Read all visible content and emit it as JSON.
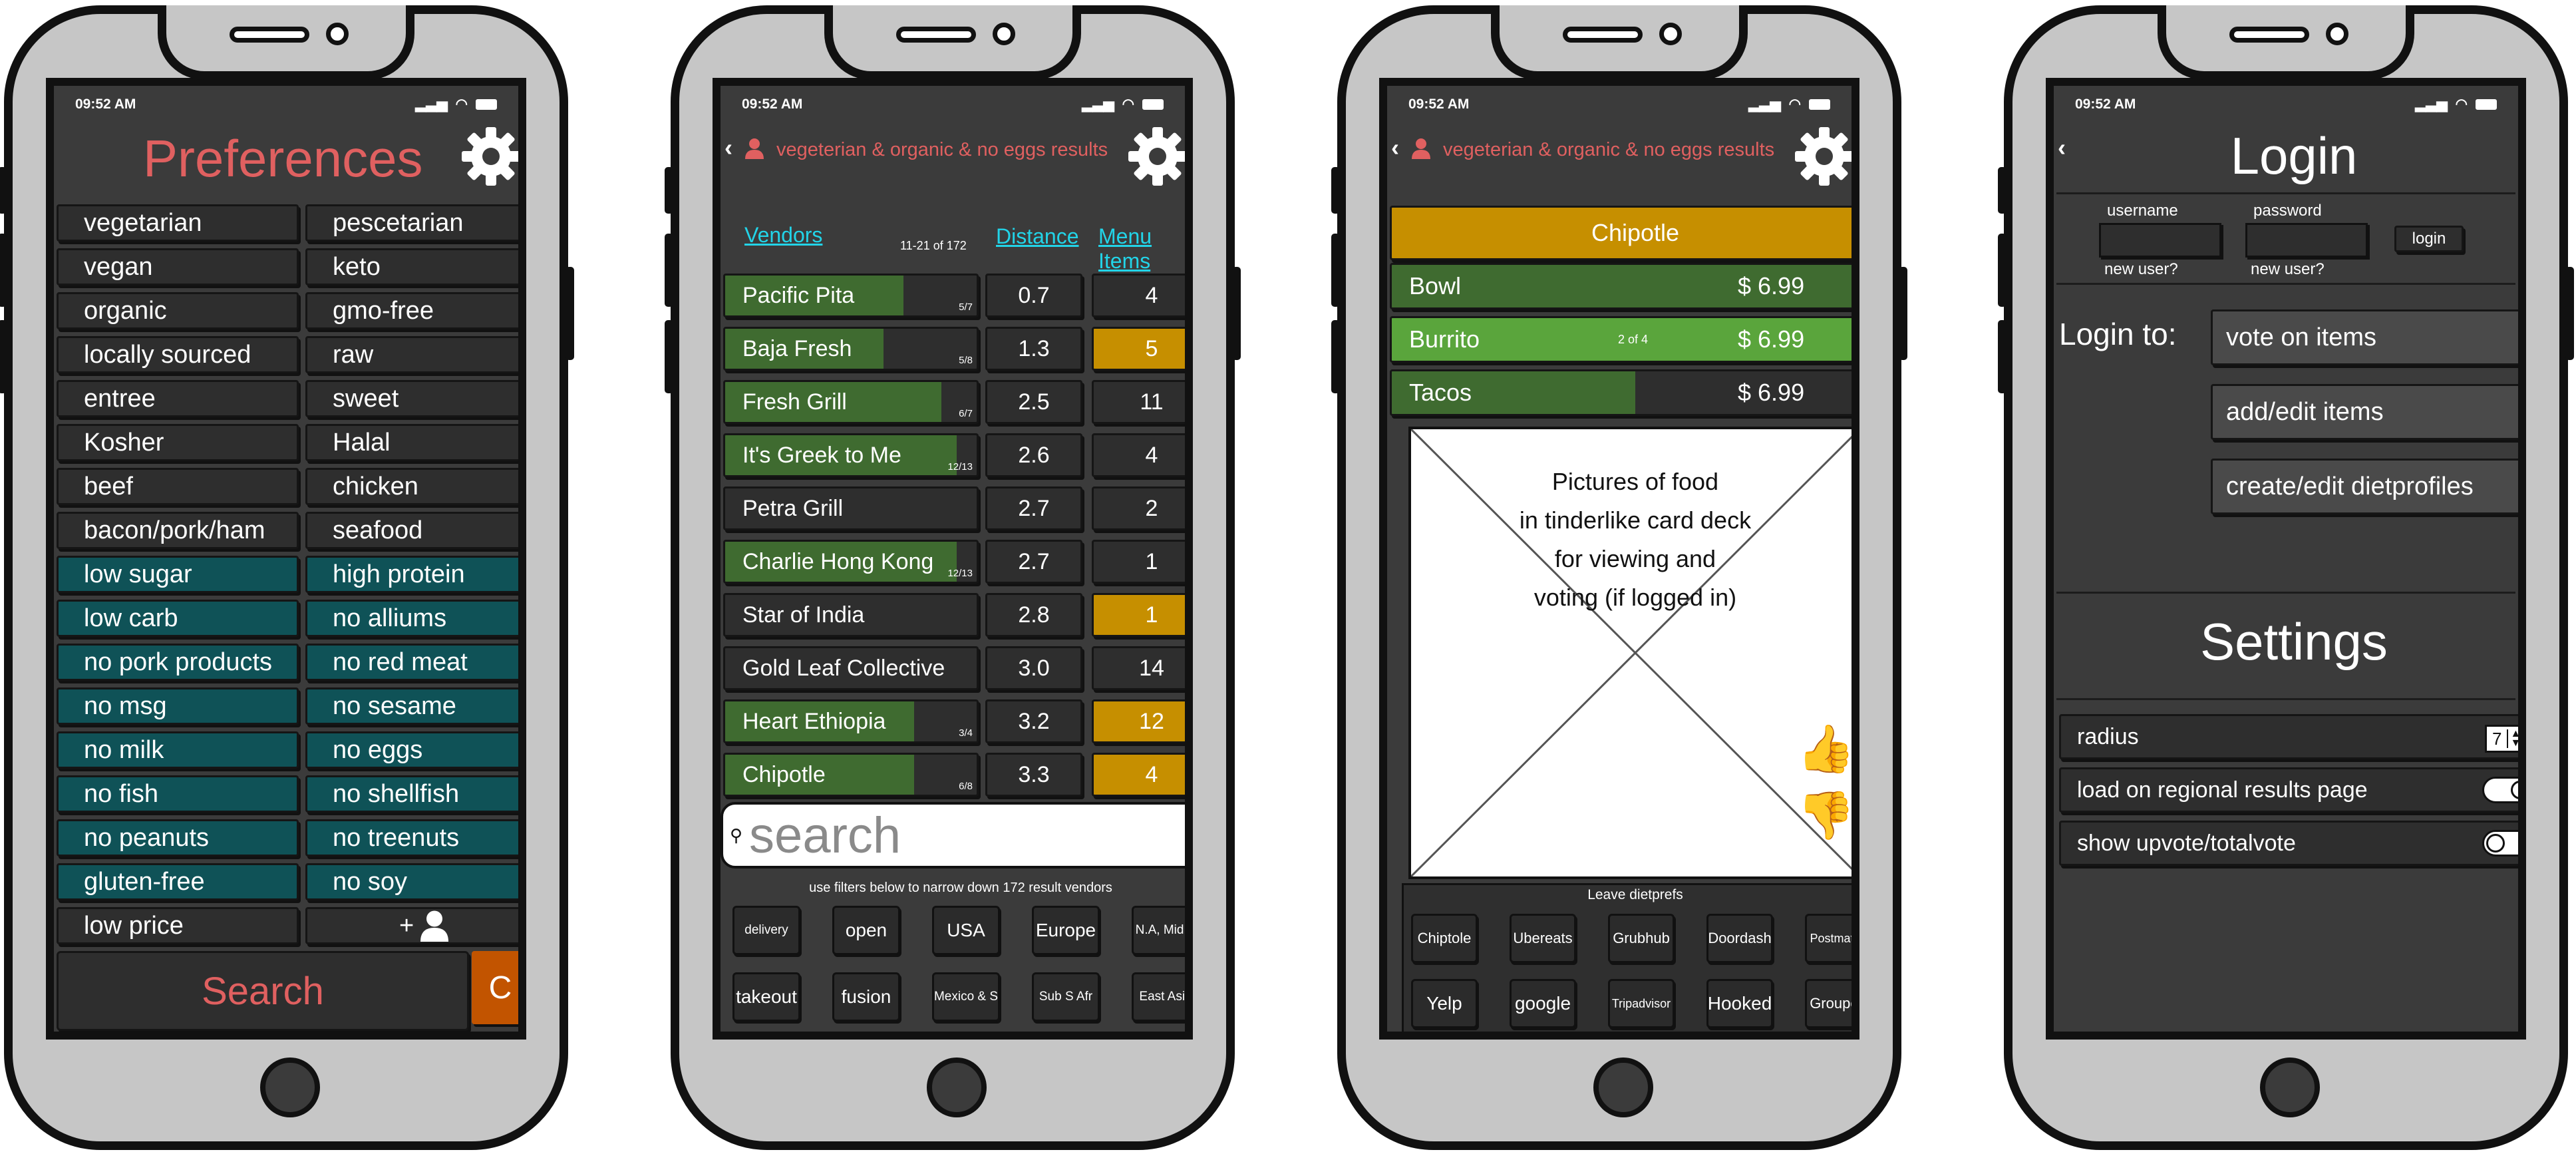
{
  "status_time": "09:52 AM",
  "colors": {
    "accent_red": "#e06060",
    "teal": "#0f5257",
    "green": "#3f6b30",
    "gold": "#c68f00",
    "link_cyan": "#22d4e8",
    "orange": "#c25400"
  },
  "preferences": {
    "title": "Preferences",
    "items": [
      {
        "label": "vegetarian",
        "active": false
      },
      {
        "label": "pescetarian",
        "active": false
      },
      {
        "label": "vegan",
        "active": false
      },
      {
        "label": "keto",
        "active": false
      },
      {
        "label": "organic",
        "active": false
      },
      {
        "label": "gmo-free",
        "active": false
      },
      {
        "label": "locally sourced",
        "active": false
      },
      {
        "label": "raw",
        "active": false
      },
      {
        "label": "entree",
        "active": false
      },
      {
        "label": "sweet",
        "active": false
      },
      {
        "label": "Kosher",
        "active": false
      },
      {
        "label": "Halal",
        "active": false
      },
      {
        "label": "beef",
        "active": false
      },
      {
        "label": "chicken",
        "active": false
      },
      {
        "label": "bacon/pork/ham",
        "active": false
      },
      {
        "label": "seafood",
        "active": false
      },
      {
        "label": "low sugar",
        "active": true
      },
      {
        "label": "high protein",
        "active": true
      },
      {
        "label": "low carb",
        "active": true
      },
      {
        "label": "no alliums",
        "active": true
      },
      {
        "label": "no pork products",
        "active": true
      },
      {
        "label": "no red meat",
        "active": true
      },
      {
        "label": "no msg",
        "active": true
      },
      {
        "label": "no sesame",
        "active": true
      },
      {
        "label": "no milk",
        "active": true
      },
      {
        "label": "no eggs",
        "active": true
      },
      {
        "label": "no fish",
        "active": true
      },
      {
        "label": "no shellfish",
        "active": true
      },
      {
        "label": "no peanuts",
        "active": true
      },
      {
        "label": "no treenuts",
        "active": true
      },
      {
        "label": "gluten-free",
        "active": true
      },
      {
        "label": "no soy",
        "active": true
      },
      {
        "label": "low price",
        "active": false
      },
      {
        "label": "+",
        "active": false
      }
    ],
    "search_label": "Search",
    "clear_label": "C"
  },
  "results": {
    "header": "vegeterian & organic & no eggs results",
    "col_vendors": "Vendors",
    "col_distance": "Distance",
    "col_menu": "Menu Items",
    "range": "11-21 of 172",
    "rows": [
      {
        "name": "Pacific Pita",
        "match": "5/7",
        "frac": 0.71,
        "distance": "0.7",
        "menu": "4",
        "menu_highlight": false
      },
      {
        "name": "Baja Fresh",
        "match": "5/8",
        "frac": 0.63,
        "distance": "1.3",
        "menu": "5",
        "menu_highlight": true
      },
      {
        "name": "Fresh Grill",
        "match": "6/7",
        "frac": 0.86,
        "distance": "2.5",
        "menu": "11",
        "menu_highlight": false
      },
      {
        "name": "It's Greek to Me",
        "match": "12/13",
        "frac": 0.92,
        "distance": "2.6",
        "menu": "4",
        "menu_highlight": false
      },
      {
        "name": "Petra Grill",
        "match": "",
        "frac": 0,
        "distance": "2.7",
        "menu": "2",
        "menu_highlight": false
      },
      {
        "name": "Charlie Hong Kong",
        "match": "12/13",
        "frac": 0.92,
        "distance": "2.7",
        "menu": "1",
        "menu_highlight": false
      },
      {
        "name": "Star of India",
        "match": "",
        "frac": 0,
        "distance": "2.8",
        "menu": "1",
        "menu_highlight": true
      },
      {
        "name": "Gold Leaf Collective",
        "match": "",
        "frac": 0,
        "distance": "3.0",
        "menu": "14",
        "menu_highlight": false
      },
      {
        "name": "Heart Ethiopia",
        "match": "3/4",
        "frac": 0.75,
        "distance": "3.2",
        "menu": "12",
        "menu_highlight": true
      },
      {
        "name": "Chipotle",
        "match": "6/8",
        "frac": 0.75,
        "distance": "3.3",
        "menu": "4",
        "menu_highlight": true
      }
    ],
    "search_placeholder": "search",
    "filter_note": "use filters below to narrow down 172 result vendors",
    "filters": [
      "delivery",
      "open",
      "USA",
      "Europe",
      "N.A, Mid E",
      "takeout",
      "fusion",
      "Mexico & S",
      "Sub S Afr",
      "East Asia"
    ]
  },
  "menu": {
    "header": "vegeterian & organic & no eggs results",
    "vendor": "Chipotle",
    "items": [
      {
        "name": "Bowl",
        "price": "$ 6.99",
        "frac": 1.0,
        "selected": false,
        "note": ""
      },
      {
        "name": "Burrito",
        "price": "$ 6.99",
        "frac": 1.0,
        "selected": true,
        "note": "2 of 4"
      },
      {
        "name": "Tacos",
        "price": "$ 6.99",
        "frac": 0.5,
        "selected": false,
        "note": ""
      }
    ],
    "card_text": [
      "Pictures of food",
      "in tinderlike card deck",
      "for viewing and",
      "voting (if logged in)"
    ],
    "leave_label": "Leave dietprefs",
    "services": [
      "Chiptole",
      "Ubereats",
      "Grubhub",
      "Doordash",
      "Postmates",
      "Yelp",
      "google",
      "Tripadvisor",
      "Hooked",
      "Groupon"
    ]
  },
  "login": {
    "title": "Login",
    "username_label": "username",
    "password_label": "password",
    "login_button": "login",
    "new_user": "new user?",
    "login_to": "Login to:",
    "actions": [
      "vote on items",
      "add/edit items",
      "create/edit dietprofiles"
    ],
    "settings_title": "Settings",
    "radius_label": "radius",
    "radius_value": "7",
    "regional_label": "load on regional results page",
    "regional_on": true,
    "upvote_label": "show upvote/totalvote",
    "upvote_on": false
  }
}
